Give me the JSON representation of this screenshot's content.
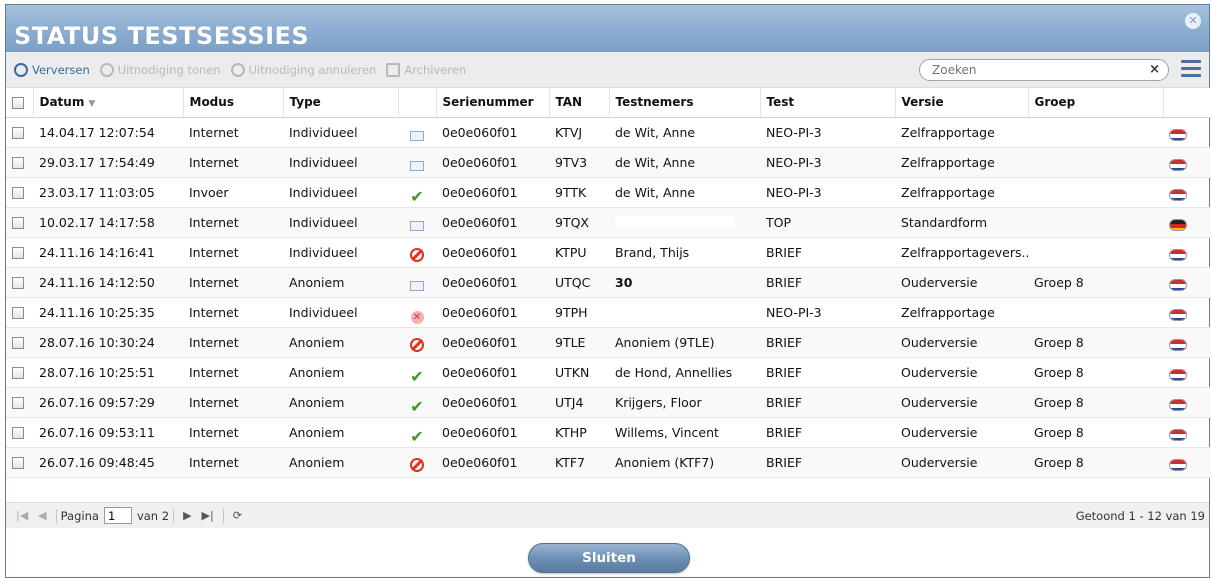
{
  "window": {
    "title": "STATUS TESTSESSIES"
  },
  "toolbar": {
    "refresh_label": "Verversen",
    "show_invite_label": "Uitnodiging tonen",
    "cancel_invite_label": "Uitnodiging annuleren",
    "archive_label": "Archiveren",
    "search_placeholder": "Zoeken",
    "clear_label": "×"
  },
  "table": {
    "headers": {
      "datum": "Datum",
      "modus": "Modus",
      "type": "Type",
      "status": "",
      "serienummer": "Serienummer",
      "tan": "TAN",
      "testnemers": "Testnemers",
      "test": "Test",
      "versie": "Versie",
      "groep": "Groep"
    },
    "rows": [
      {
        "datum": "14.04.17 12:07:54",
        "modus": "Internet",
        "type": "Individueel",
        "status": "mail-icon",
        "serienummer": "0e0e060f01",
        "tan": "KTVJ",
        "testnemers": "de Wit, Anne",
        "test": "NEO-PI-3",
        "versie": "Zelfrapportage",
        "groep": "",
        "flag": "nl"
      },
      {
        "datum": "29.03.17 17:54:49",
        "modus": "Internet",
        "type": "Individueel",
        "status": "mail-icon",
        "serienummer": "0e0e060f01",
        "tan": "9TV3",
        "testnemers": "de Wit, Anne",
        "test": "NEO-PI-3",
        "versie": "Zelfrapportage",
        "groep": "",
        "flag": "nl"
      },
      {
        "datum": "23.03.17 11:03:05",
        "modus": "Invoer",
        "type": "Individueel",
        "status": "check-icon",
        "serienummer": "0e0e060f01",
        "tan": "9TTK",
        "testnemers": "de Wit, Anne",
        "test": "NEO-PI-3",
        "versie": "Zelfrapportage",
        "groep": "",
        "flag": "nl"
      },
      {
        "datum": "10.02.17 14:17:58",
        "modus": "Internet",
        "type": "Individueel",
        "status": "mail-icon",
        "serienummer": "0e0e060f01",
        "tan": "9TQX",
        "testnemers": "",
        "test": "TOP",
        "versie": "Standardform",
        "groep": "",
        "flag": "de"
      },
      {
        "datum": "24.11.16 14:16:41",
        "modus": "Internet",
        "type": "Individueel",
        "status": "block-icon",
        "serienummer": "0e0e060f01",
        "tan": "KTPU",
        "testnemers": "Brand, Thijs",
        "test": "BRIEF",
        "versie": "Zelfrapportagevers...",
        "groep": "",
        "flag": "nl"
      },
      {
        "datum": "24.11.16 14:12:50",
        "modus": "Internet",
        "type": "Anoniem",
        "status": "mail-open-icon",
        "serienummer": "0e0e060f01",
        "tan": "UTQC",
        "testnemers": "30",
        "test": "BRIEF",
        "versie": "Ouderversie",
        "groep": "Groep 8",
        "flag": "nl"
      },
      {
        "datum": "24.11.16 10:25:35",
        "modus": "Internet",
        "type": "Individueel",
        "status": "x-icon",
        "serienummer": "0e0e060f01",
        "tan": "9TPH",
        "testnemers": "",
        "test": "NEO-PI-3",
        "versie": "Zelfrapportage",
        "groep": "",
        "flag": "nl"
      },
      {
        "datum": "28.07.16 10:30:24",
        "modus": "Internet",
        "type": "Anoniem",
        "status": "block-icon",
        "serienummer": "0e0e060f01",
        "tan": "9TLE",
        "testnemers": "Anoniem (9TLE)",
        "test": "BRIEF",
        "versie": "Ouderversie",
        "groep": "Groep 8",
        "flag": "nl"
      },
      {
        "datum": "28.07.16 10:25:51",
        "modus": "Internet",
        "type": "Anoniem",
        "status": "check-icon",
        "serienummer": "0e0e060f01",
        "tan": "UTKN",
        "testnemers": "de Hond, Annellies",
        "test": "BRIEF",
        "versie": "Ouderversie",
        "groep": "Groep 8",
        "flag": "nl"
      },
      {
        "datum": "26.07.16 09:57:29",
        "modus": "Internet",
        "type": "Anoniem",
        "status": "check-icon",
        "serienummer": "0e0e060f01",
        "tan": "UTJ4",
        "testnemers": "Krijgers, Floor",
        "test": "BRIEF",
        "versie": "Ouderversie",
        "groep": "Groep 8",
        "flag": "nl"
      },
      {
        "datum": "26.07.16 09:53:11",
        "modus": "Internet",
        "type": "Anoniem",
        "status": "check-icon",
        "serienummer": "0e0e060f01",
        "tan": "KTHP",
        "testnemers": "Willems, Vincent",
        "test": "BRIEF",
        "versie": "Ouderversie",
        "groep": "Groep 8",
        "flag": "nl"
      },
      {
        "datum": "26.07.16 09:48:45",
        "modus": "Internet",
        "type": "Anoniem",
        "status": "block-icon",
        "serienummer": "0e0e060f01",
        "tan": "KTF7",
        "testnemers": "Anoniem (KTF7)",
        "test": "BRIEF",
        "versie": "Ouderversie",
        "groep": "Groep 8",
        "flag": "nl"
      }
    ]
  },
  "pager": {
    "page_label": "Pagina",
    "page_value": "1",
    "of_label": "van 2",
    "info": "Getoond 1 - 12 van 19"
  },
  "footer": {
    "close_label": "Sluiten"
  },
  "colors": {
    "title_bar": "#8fb0d3",
    "accent": "#3b6aa0",
    "check": "#3d9a1f",
    "block": "#e0321e"
  }
}
